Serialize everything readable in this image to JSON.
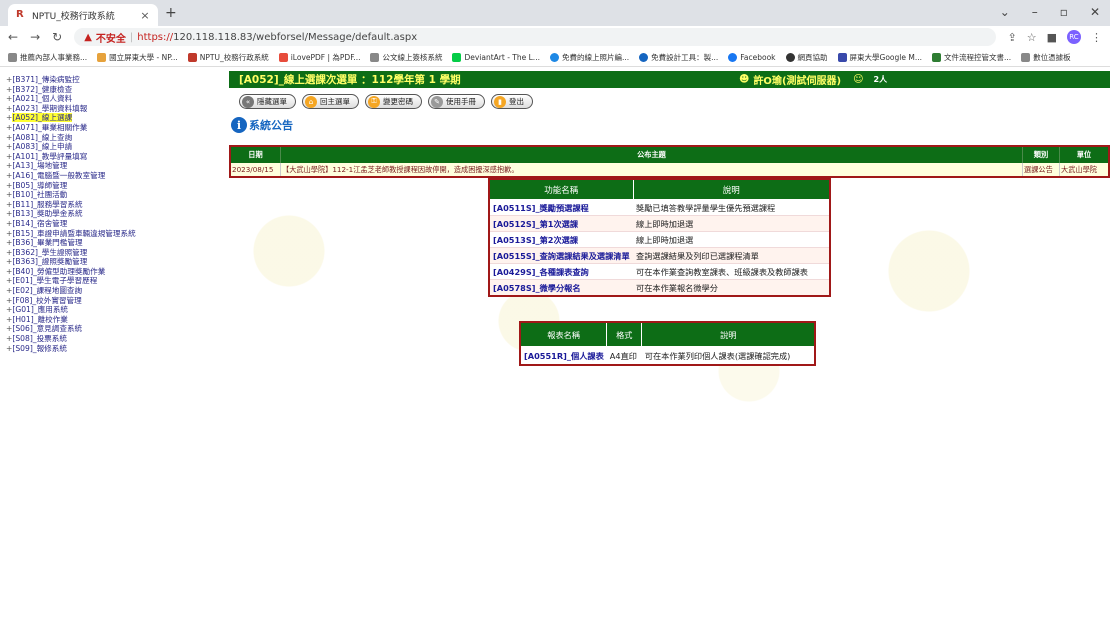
{
  "browser": {
    "tab_title": "NPTU_校務行政系統",
    "address": {
      "warning": "不安全",
      "scheme": "https://",
      "rest": "120.118.118.83/webforsel/Message/default.aspx"
    },
    "avatar_text": "RC",
    "bookmarks": [
      "推薦內部人事業務...",
      "國立屏東大學 - NP...",
      "NPTU_校務行政系統",
      "iLovePDF | 為PDF...",
      "公文線上簽核系統",
      "DeviantArt - The L...",
      "免費的線上照片編...",
      "免費設計工具：製...",
      "Facebook",
      "網頁協助",
      "屏東大學Google M...",
      "文件流程控管文書...",
      "數位憑據板"
    ]
  },
  "menu": [
    "[B371]_傳染病監控",
    "[B372]_健康檢查",
    "[A021]_個人資料",
    "[A023]_學期資料填報",
    "[A052]_線上選課",
    "[A071]_畢業相關作業",
    "[A081]_線上查詢",
    "[A083]_線上申請",
    "[A101]_教學評量填寫",
    "[A13]_場地管理",
    "[A16]_電腦暨一般教室管理",
    "[B05]_導師管理",
    "[B10]_社團活動",
    "[B11]_服務學習系統",
    "[B13]_獎助學金系統",
    "[B14]_宿舍管理",
    "[B15]_車證申請暨車輛違規管理系統",
    "[B36]_畢業門檻管理",
    "[B362]_學生證照管理",
    "[B363]_證照獎勵管理",
    "[B40]_勞僱型助理獎勵作業",
    "[E01]_學生電子學習歷程",
    "[E02]_課程地圖查詢",
    "[F08]_校外實習管理",
    "[G01]_應用系統",
    "[H01]_離校作業",
    "[S06]_意見調查系統",
    "[S08]_投票系統",
    "[S09]_報修系統"
  ],
  "menu_active_index": 4,
  "header": {
    "title": "[A052]_線上選課次選單 ：112學年第 1 學期",
    "user": "許O瑜(測試伺服器)",
    "online_count": "2人"
  },
  "buttons": [
    "隱藏選單",
    "回主選單",
    "變更密碼",
    "使用手冊",
    "登出"
  ],
  "system_notice": {
    "icon_letter": "i",
    "label": "系統公告"
  },
  "announcements": {
    "headers": [
      "日期",
      "公布主題",
      "類別",
      "單位"
    ],
    "rows": [
      [
        "2023/08/15",
        "【大武山學院】112-1江孟芝老師教授課程因故停開，造成困擾深感抱歉。",
        "選課公告",
        "大武山學院"
      ]
    ]
  },
  "functions": {
    "headers": [
      "功能名稱",
      "說明"
    ],
    "rows": [
      [
        "[A0511S]_獎勵預選課程",
        "獎勵已填答教學評量學生優先預選課程"
      ],
      [
        "[A0512S]_第1次選課",
        "線上即時加退選"
      ],
      [
        "[A0513S]_第2次選課",
        "線上即時加退選"
      ],
      [
        "[A0515S]_查詢選課結果及選課清單",
        "查詢選課結果及列印已選課程清單"
      ],
      [
        "[A0429S]_各種課表查詢",
        "可在本作業查詢教室課表、班級課表及教師課表"
      ],
      [
        "[A0578S]_微學分報名",
        "可在本作業報名微學分"
      ]
    ]
  },
  "reports": {
    "headers": [
      "報表名稱",
      "格式",
      "說明"
    ],
    "rows": [
      [
        "[A0551R]_個人課表",
        "A4直印",
        "可在本作業列印個人課表(選課確認完成)"
      ]
    ]
  },
  "colors": {
    "header_green": "#0d6d16",
    "border_red": "#a01818",
    "link_blue": "#1a1a99",
    "title_yellow": "#ffff66"
  }
}
